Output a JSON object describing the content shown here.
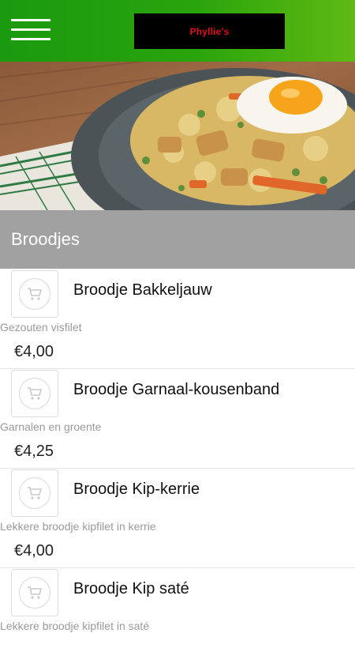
{
  "header": {
    "logo_text": "Phyllie's",
    "bg_color": "#2aa40d"
  },
  "category": {
    "title": "Broodjes"
  },
  "products": [
    {
      "name": "Broodje Bakkeljauw",
      "description": "Gezouten visfilet",
      "price": "€4,00"
    },
    {
      "name": "Broodje Garnaal-kousenband",
      "description": "Garnalen en groente",
      "price": "€4,25"
    },
    {
      "name": "Broodje Kip-kerrie",
      "description": "Lekkere broodje kipfilet in kerrie",
      "price": "€4,00"
    },
    {
      "name": "Broodje Kip saté",
      "description": "Lekkere broodje kipfilet in saté",
      "price": ""
    }
  ],
  "icons": {
    "menu": "hamburger-menu-icon",
    "cart": "shopping-cart-icon"
  }
}
